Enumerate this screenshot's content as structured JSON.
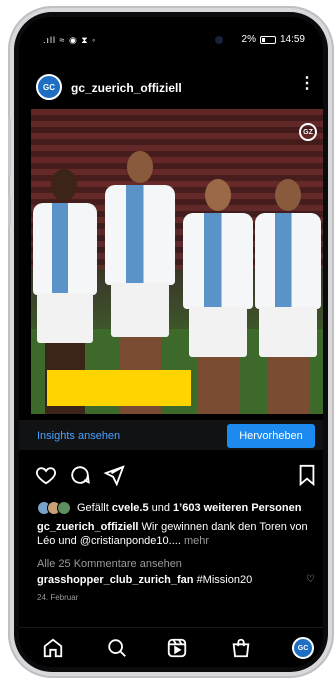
{
  "status_bar": {
    "left_icons": ".ıll ≈ ◉ ⧗ ◦",
    "battery_percent": "2%",
    "time": "14:59"
  },
  "post": {
    "username": "gc_zuerich_offiziell",
    "avatar_text": "GC",
    "photo_logo_text": "GZ",
    "insights_label": "Insights ansehen",
    "promote_label": "Hervorheben",
    "likes_prefix": "Gefällt",
    "likes_user": "cvele.5",
    "likes_connector": "und",
    "likes_count_text": "1’603 weiteren Personen",
    "caption_user": "gc_zuerich_offiziell",
    "caption_text": "Wir gewinnen dank den Toren von Léo und @cristianponde10....",
    "caption_more": "mehr",
    "view_comments": "Alle 25 Kommentare ansehen",
    "comment_user": "grasshopper_club_zurich_fan",
    "comment_text": "#Mission20",
    "date": "24. Februar"
  },
  "colors": {
    "accent_blue": "#1d8af0",
    "link_blue": "#4aa3ff",
    "redaction_yellow": "#ffd400",
    "club_blue": "#1e6fc4"
  },
  "icons": {
    "actions": [
      "heart-icon",
      "comment-icon",
      "share-icon",
      "bookmark-icon"
    ],
    "nav": [
      "home-icon",
      "search-icon",
      "reels-icon",
      "shop-icon",
      "profile-avatar"
    ]
  }
}
